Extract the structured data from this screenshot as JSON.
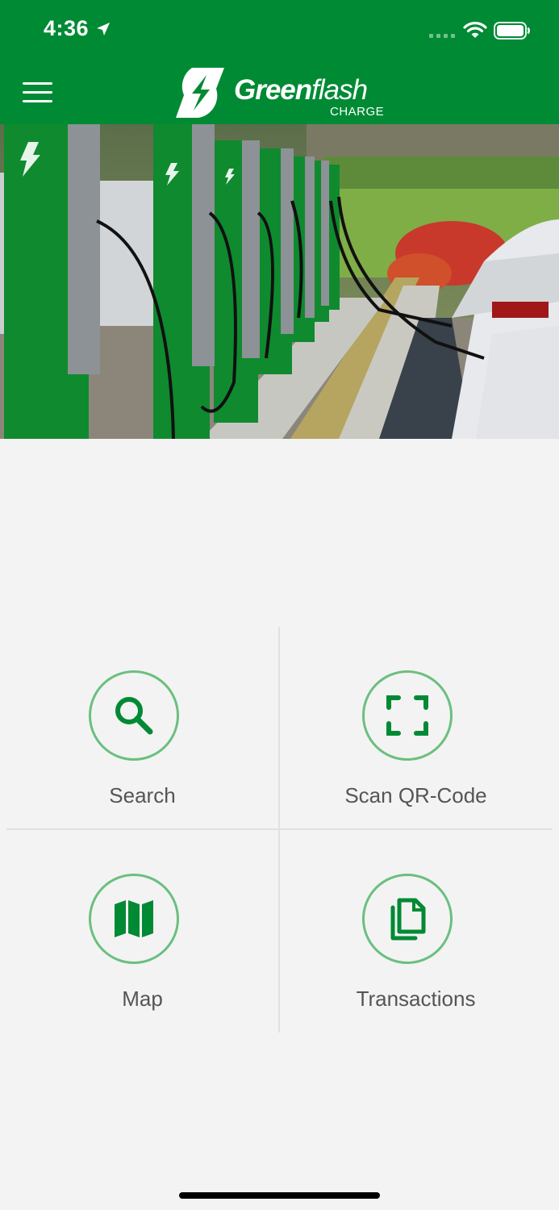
{
  "status_bar": {
    "time": "4:36"
  },
  "header": {
    "menu_icon": "hamburger-menu-icon",
    "logo_name_bold": "Green",
    "logo_name_light": "flash",
    "logo_subtitle": "CHARGE"
  },
  "hero": {
    "image": "ev-charging-stations-photo"
  },
  "actions": [
    {
      "label": "Search",
      "icon": "search-icon"
    },
    {
      "label": "Scan QR-Code",
      "icon": "qr-scan-icon"
    },
    {
      "label": "Map",
      "icon": "map-icon"
    },
    {
      "label": "Transactions",
      "icon": "documents-icon"
    }
  ],
  "colors": {
    "brand_green": "#008a34",
    "circle_border": "#6bbf7f",
    "background": "#f3f3f3"
  }
}
